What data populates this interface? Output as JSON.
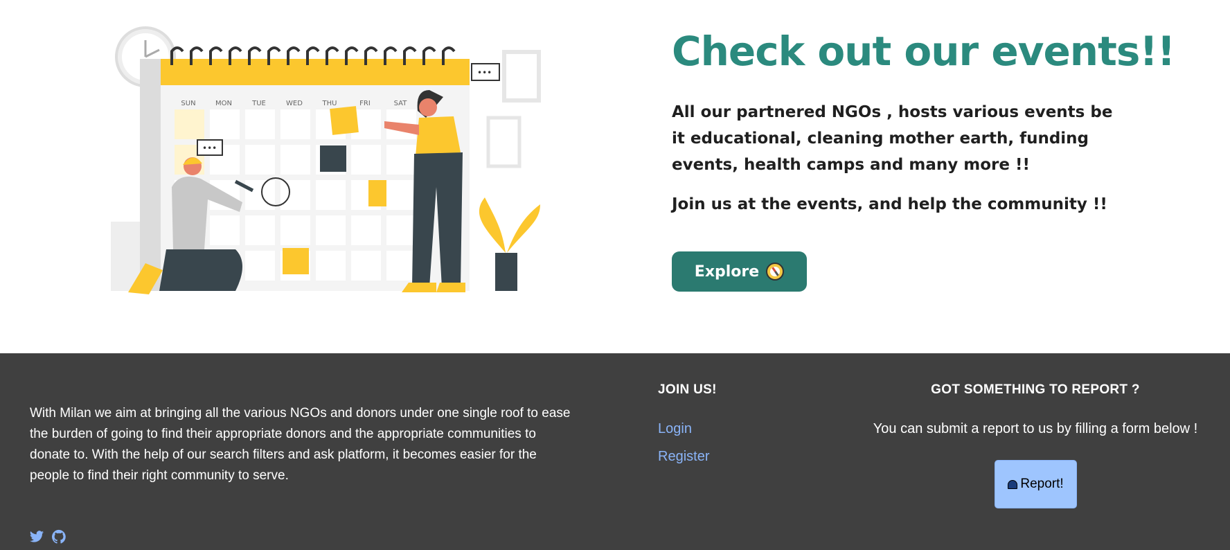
{
  "hero": {
    "title": "Check out our events!!",
    "description": "All our partnered NGOs , hosts various events be it educational, cleaning mother earth, funding events, health camps and many more !!",
    "join_text": "Join us at the events, and help the community !!",
    "explore_label": "Explore",
    "explore_icon": "compass-icon",
    "calendar_days": [
      "SUN",
      "MON",
      "TUE",
      "WED",
      "THU",
      "FRI",
      "SAT"
    ],
    "accent_color": "#2b8a7e"
  },
  "footer": {
    "about": "With Milan we aim at bringing all the various NGOs and donors under one single roof to ease the burden of going to find their appropriate donors and the appropriate communities to donate to. With the help of our search filters and ask platform, it becomes easier for the people to find their right community to serve.",
    "join_heading": "JOIN US!",
    "links": [
      "Login",
      "Register"
    ],
    "report_heading": "GOT SOMETHING TO REPORT ?",
    "report_text": "You can submit a report to us by filling a form below !",
    "report_button": "Report!",
    "report_icon": "siren-icon",
    "social_icons": [
      "twitter-icon",
      "github-icon"
    ],
    "background_color": "#404040",
    "link_color": "#8ab4f8"
  }
}
